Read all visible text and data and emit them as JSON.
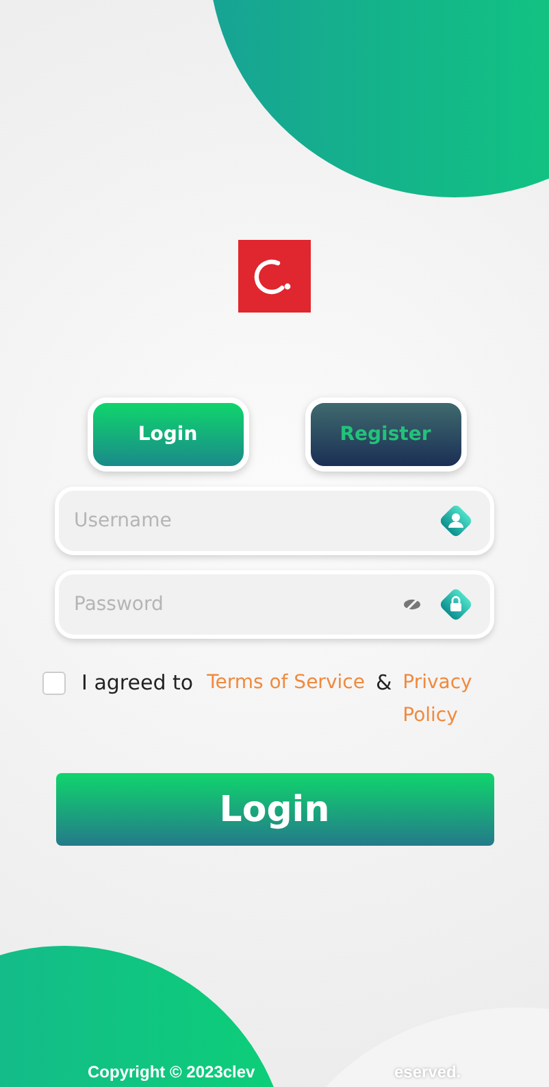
{
  "tabs": [
    {
      "label": "Login",
      "selected": true
    },
    {
      "label": "Register",
      "selected": false
    }
  ],
  "username": {
    "placeholder": "Username"
  },
  "password": {
    "placeholder": "Password"
  },
  "agreement": {
    "checked": false,
    "text": "I agreed to",
    "terms": "Terms of Service",
    "and": "&",
    "privacy": "Privacy Policy"
  },
  "submit": "Login",
  "footer": [
    "Copyright © 2023clev",
    "eserved."
  ]
}
